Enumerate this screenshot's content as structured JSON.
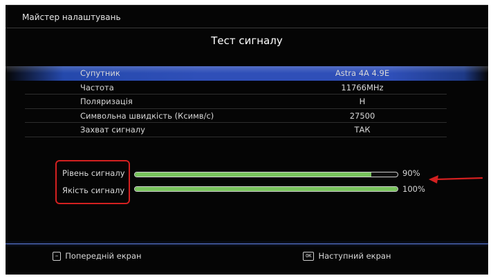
{
  "header": {
    "wizard_title": "Майстер налаштувань",
    "screen_title": "Тест сигналу"
  },
  "params": [
    {
      "label": "Супутник",
      "value": "Astra 4A 4.9E",
      "selected": true
    },
    {
      "label": "Частота",
      "value": "11766MHz",
      "selected": false
    },
    {
      "label": "Поляризація",
      "value": "H",
      "selected": false
    },
    {
      "label": "Символьна швидкість (Ксимв/с)",
      "value": "27500",
      "selected": false
    },
    {
      "label": "Захват сигналу",
      "value": "ТАК",
      "selected": false
    }
  ],
  "meters": {
    "level": {
      "label": "Рівень сигналу",
      "percent_text": "90%",
      "fraction": 0.9
    },
    "quality": {
      "label": "Якість сигналу",
      "percent_text": "100%",
      "fraction": 1.0
    }
  },
  "footer": {
    "prev_key": "⇦",
    "prev_label": "Попередній екран",
    "next_key": "OK",
    "next_label": "Наступний екран"
  },
  "colors": {
    "selection": "#2f4fb8",
    "meter_fill": "#79c35d",
    "annotation_red": "#d42020"
  },
  "icons": {
    "annotation_arrow": "left-arrow-icon"
  }
}
